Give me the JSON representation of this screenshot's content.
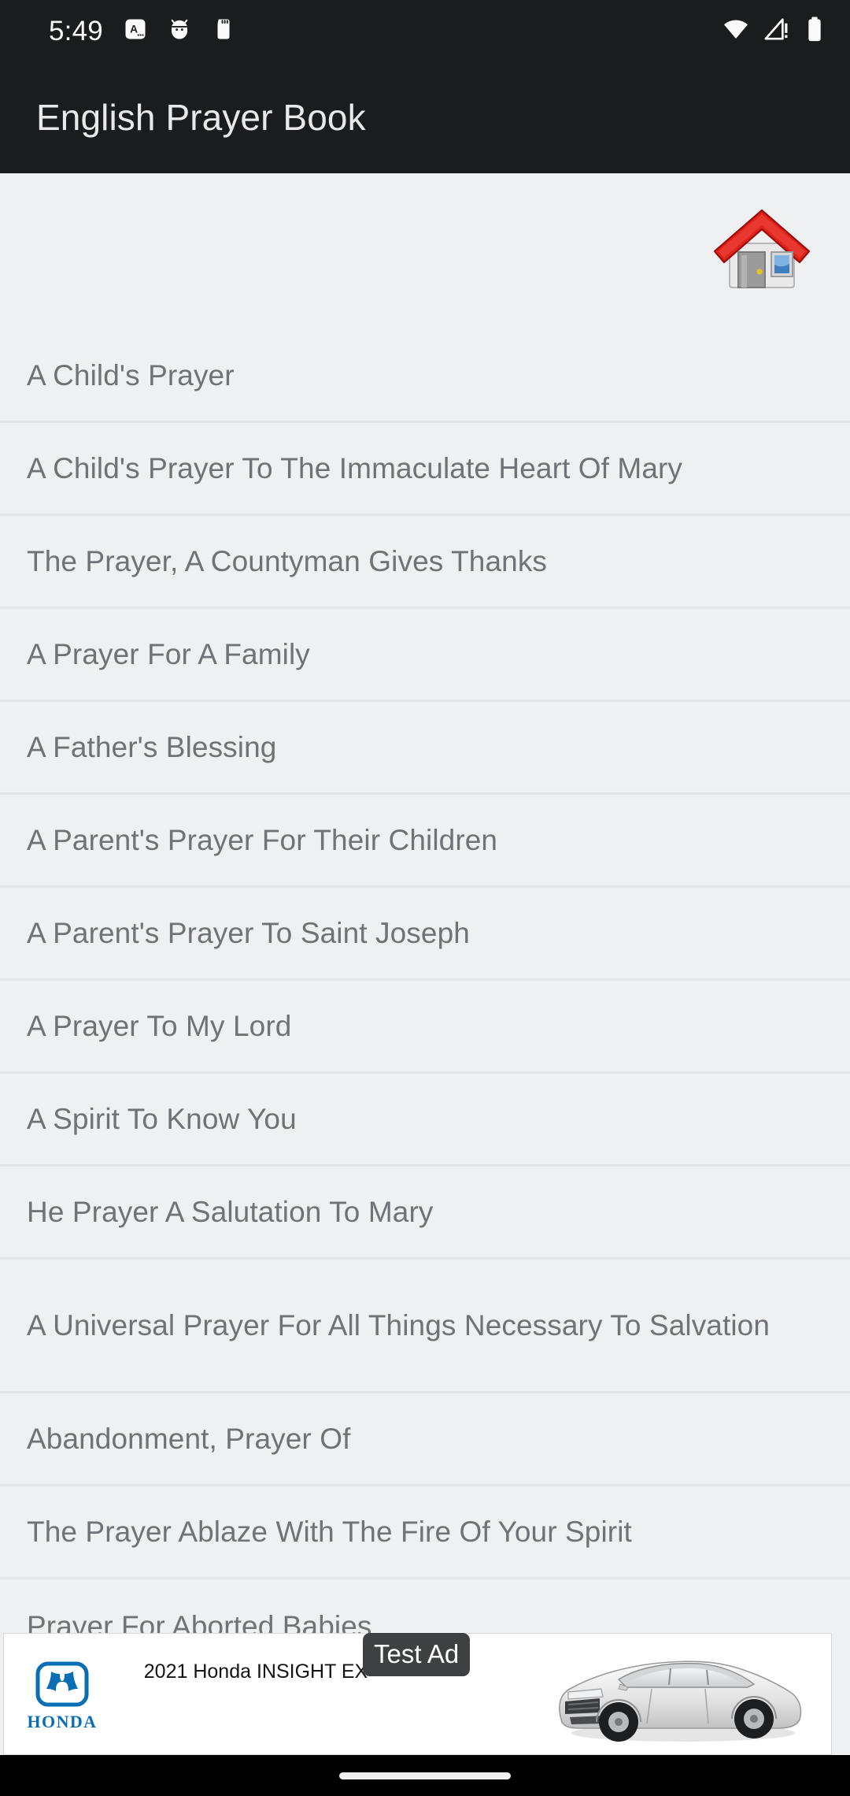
{
  "statusbar": {
    "time": "5:49",
    "left_icons": [
      {
        "name": "keyboard-language-icon",
        "glyph": "A"
      },
      {
        "name": "android-debug-icon",
        "glyph": "android"
      },
      {
        "name": "sd-card-icon",
        "glyph": "sdcard"
      }
    ],
    "right_icons": [
      {
        "name": "wifi-icon",
        "glyph": "wifi"
      },
      {
        "name": "cellular-signal-alert-icon",
        "glyph": "signal-alert"
      },
      {
        "name": "battery-icon",
        "glyph": "battery"
      }
    ],
    "background_color": "#1b1c1e",
    "foreground_color": "#fafafa"
  },
  "appbar": {
    "title": "English Prayer Book",
    "background_color": "#1b1c1e",
    "title_color": "#e9e9e9"
  },
  "home": {
    "icon_name": "home-icon",
    "roof_color": "#e0231c",
    "wall_color": "#e8e8e8",
    "window_color": "#3f7fc0",
    "door_color": "#9b9b9b",
    "knob_color": "#e8c41f"
  },
  "list": {
    "background_color": "#eff0f2",
    "divider_color": "#e3e4e6",
    "text_color": "#6f7276",
    "items": [
      {
        "label": "A Child's Prayer"
      },
      {
        "label": "A Child's Prayer To The Immaculate Heart Of Mary"
      },
      {
        "label": "The Prayer, A Countyman Gives Thanks"
      },
      {
        "label": "A Prayer For A Family"
      },
      {
        "label": "A Father's Blessing"
      },
      {
        "label": "A Parent's Prayer For Their Children"
      },
      {
        "label": "A Parent's Prayer To Saint Joseph"
      },
      {
        "label": "A Prayer To My Lord"
      },
      {
        "label": "A Spirit To Know You"
      },
      {
        "label": "He Prayer A Salutation To Mary"
      },
      {
        "label": "A Universal Prayer For All Things Necessary To Salvation"
      },
      {
        "label": "Abandonment, Prayer Of"
      },
      {
        "label": "The Prayer Ablaze With The Fire Of Your Spirit"
      },
      {
        "label": "Prayer For Aborted Babies"
      }
    ]
  },
  "ad": {
    "badge_label": "Test Ad",
    "headline": "2021 Honda INSIGHT EX",
    "brand": "HONDA",
    "brand_color": "#0a6eb4",
    "badge_background": "#3f4042",
    "background_color": "#ffffff"
  },
  "navbar": {
    "background_color": "#000000",
    "pill_name": "home-gesture-pill"
  }
}
